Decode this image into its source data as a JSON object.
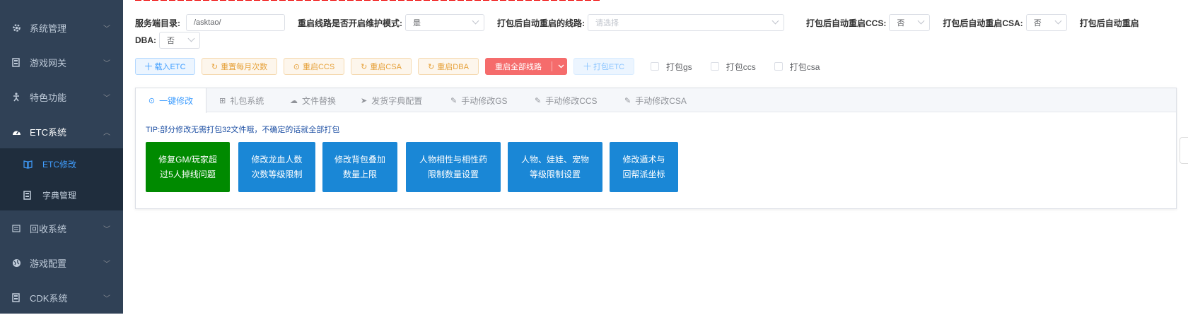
{
  "sidebar": {
    "items": [
      {
        "label": "系统管理",
        "icon": "gear-icon"
      },
      {
        "label": "游戏网关",
        "icon": "server-icon"
      },
      {
        "label": "特色功能",
        "icon": "accessibility-icon"
      },
      {
        "label": "ETC系统",
        "icon": "dashboard-icon"
      },
      {
        "label": "回收系统",
        "icon": "list-icon"
      },
      {
        "label": "游戏配置",
        "icon": "globe-icon"
      },
      {
        "label": "CDK系统",
        "icon": "server-icon"
      }
    ],
    "subitems": [
      {
        "label": "ETC修改",
        "icon": "book-icon",
        "active": true
      },
      {
        "label": "字典管理",
        "icon": "server-icon",
        "active": false
      }
    ]
  },
  "form": {
    "server_dir_label": "服务端目录:",
    "server_dir_value": "/asktao/",
    "maint_mode_label": "重启线路是否开启维护模式:",
    "maint_mode_value": "是",
    "restart_lines_label": "打包后自动重启的线路:",
    "restart_lines_placeholder": "请选择",
    "restart_ccs_label": "打包后自动重启CCS:",
    "restart_ccs_value": "否",
    "restart_csa_label": "打包后自动重启CSA:",
    "restart_csa_value": "否",
    "restart_dba_label_part1": "打包后自动重启",
    "restart_dba_label_part2": "DBA:",
    "restart_dba_value": "否"
  },
  "toolbar": {
    "load_etc": "十 载入ETC",
    "reset_monthly": "重置每月次数",
    "restart_ccs": "重启CCS",
    "restart_csa": "重启CSA",
    "restart_dba": "重启DBA",
    "restart_all": "重启全部线路",
    "pack_etc": "十 打包ETC",
    "pack_gs": "打包gs",
    "pack_ccs": "打包ccs",
    "pack_csa": "打包csa"
  },
  "tabs": [
    {
      "label": "一键修改",
      "icon": "check-circle-icon",
      "active": true
    },
    {
      "label": "礼包系统",
      "icon": "gift-icon",
      "active": false
    },
    {
      "label": "文件替换",
      "icon": "cloud-icon",
      "active": false
    },
    {
      "label": "发货字典配置",
      "icon": "send-icon",
      "active": false
    },
    {
      "label": "手动修改GS",
      "icon": "edit-icon",
      "active": false
    },
    {
      "label": "手动修改CCS",
      "icon": "edit-icon",
      "active": false
    },
    {
      "label": "手动修改CSA",
      "icon": "edit-icon",
      "active": false
    }
  ],
  "tip": "TIP:部分修改无需打包32文件哦，不确定的话就全部打包",
  "actions": [
    {
      "line1": "修复GM/玩家超",
      "line2": "过5人掉线问题",
      "color": "#008a00"
    },
    {
      "line1": "修改龙血人数",
      "line2": "次数等级限制",
      "color": "#1a87d6"
    },
    {
      "line1": "修改背包叠加",
      "line2": "数量上限",
      "color": "#1a87d6"
    },
    {
      "line1": "人物相性与相性药",
      "line2": "限制数量设置",
      "color": "#1a87d6"
    },
    {
      "line1": "人物、娃娃、宠物",
      "line2": "等级限制设置",
      "color": "#1a87d6"
    },
    {
      "line1": "修改遁术与",
      "line2": "回帮派坐标",
      "color": "#1a87d6"
    }
  ],
  "colors": {
    "sidebar_bg": "#304156",
    "submenu_bg": "#1f2d3d",
    "accent": "#409eff",
    "danger": "#f56c6c",
    "warning": "#e6a23c"
  }
}
